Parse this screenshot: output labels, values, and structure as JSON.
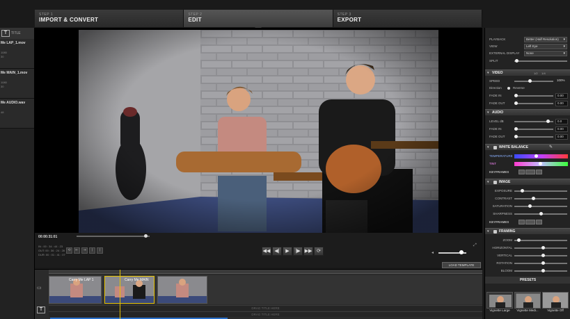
{
  "steps": [
    {
      "num": "STEP 1",
      "name": "IMPORT & CONVERT"
    },
    {
      "num": "STEP 2",
      "name": "EDIT"
    },
    {
      "num": "STEP 3",
      "name": "EXPORT"
    }
  ],
  "bin": {
    "title_label": "TITLE",
    "clips": [
      {
        "name": "Me LAP_1.mov",
        "meta": "\n1080\n30"
      },
      {
        "name": "Me MAIN_1.mov",
        "meta": "\n1080\n30"
      },
      {
        "name": "Me AUDIO.wav",
        "meta": "\n48"
      }
    ]
  },
  "transport": {
    "timecode": "00:00:31:01",
    "inout": "IN : 00 : 34 : 44 : 23\nOUT: 00 : 36 : 24 : 28\nDUR: 00 : 01 : 41 : 07",
    "scrub_position": 0.95,
    "volume_level": 0.83,
    "load_template": "LOAD TEMPLATE",
    "small_buttons": [
      "⟲",
      "⇤",
      "⇥",
      "⟨",
      "⟩"
    ],
    "play_buttons": [
      "◀◀",
      "◀|",
      "▶",
      "|▶",
      "▶▶",
      "⟳"
    ]
  },
  "timeline": {
    "clip_title": "Carry Me LAP 1",
    "clip_title_2": "Carry Me MAIN",
    "drag_title_1": "DRAG TITLE HERE",
    "drag_title_2": "DRAG TITLE HERE"
  },
  "inspector": {
    "playback_label": "PLAYBACK",
    "playback_value": "Better (Half Resolution)",
    "view_label": "VIEW",
    "view_value": "Left Eye",
    "external_label": "EXTERNAL DISPLAY",
    "external_value": "None",
    "split_label": "SPLIT",
    "split_level": 0.02,
    "video_section": "VIDEO",
    "speed_ticks": "1/2     1/4",
    "speed_label": "SPEED",
    "speed_level": 0.4,
    "speed_value": "100%",
    "direction_label": "Direction",
    "reverse_label": "Reverse",
    "fadein_label": "FADE IN",
    "fadein_level": 0.0,
    "fadein_value": "0.00",
    "fadeout_label": "FADE OUT",
    "fadeout_level": 0.0,
    "fadeout_value": "0.00",
    "audio_section": "AUDIO",
    "level_label": "LEVEL dB",
    "level_level": 0.9,
    "level_value": "0.0",
    "afadein_label": "FADE IN",
    "afadein_value": "0.00",
    "afadeout_label": "FADE OUT",
    "afadeout_value": "0.00",
    "wb_section": "WHITE BALANCE",
    "temperature_label": "TEMPERATURE",
    "temperature_level": 0.4,
    "tint_label": "TINT",
    "tint_level": 0.48,
    "keyframes_label": "KEYFRAMES",
    "image_section": "IMAGE",
    "exposure_label": "EXPOSURE",
    "exposure_level": 0.12,
    "contrast_label": "CONTRAST",
    "contrast_level": 0.35,
    "saturation_label": "SATURATION",
    "saturation_level": 0.28,
    "sharpness_label": "SHARPNESS",
    "sharpness_level": 0.5,
    "keyframes2_label": "KEYFRAMES",
    "framing_section": "FRAMING",
    "zoom_label": "ZOOM",
    "zoom_level": 0.05,
    "horizontal_label": "HORIZONTAL",
    "horizontal_level": 0.55,
    "vertical_label": "VERTICAL",
    "vertical_level": 0.55,
    "rotation_label": "ROTATION",
    "rotation_level": 0.55,
    "bloom_label": "BLOOM",
    "bloom_level": 0.55,
    "presets_label": "PRESETS",
    "presets": [
      "Vignette Large",
      "Vignette Medi...",
      "Vignette Off"
    ]
  },
  "colors": {
    "accent": "#e6c200",
    "timeline_blue": "#2a6fc9"
  }
}
